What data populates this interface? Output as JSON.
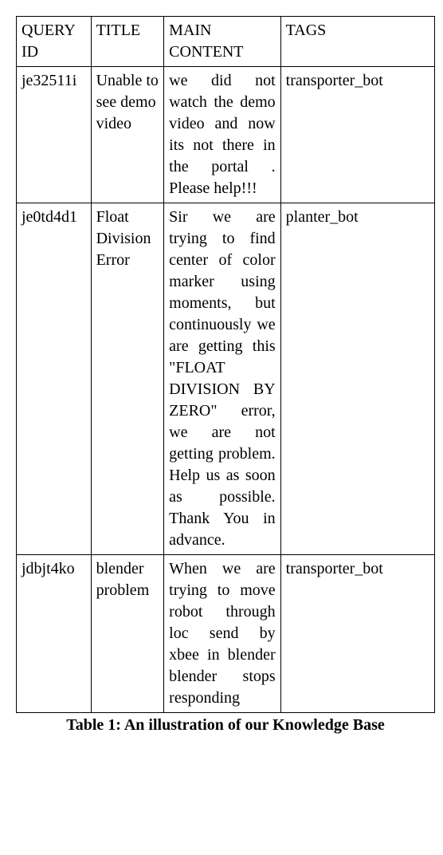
{
  "table": {
    "headers": {
      "query_id": "QUERY ID",
      "title": "TITLE",
      "main_content": "MAIN CONTENT",
      "tags": "TAGS"
    },
    "rows": [
      {
        "query_id": "je32511i",
        "title": "Unable to see demo video",
        "main_content": "we did not watch the demo video and now its not there in the portal . Please help!!!",
        "tags": "transporter_bot"
      },
      {
        "query_id": "je0td4d1",
        "title": "Float Division Error",
        "main_content": "Sir we are trying to find center of color marker using moments, but continuously we are getting this \"FLOAT DIVISION BY ZERO\" error, we are not getting problem. Help us as soon as possible. Thank You in advance.",
        "tags": "planter_bot"
      },
      {
        "query_id": "jdbjt4ko",
        "title": "blender problem",
        "main_content": "When we are trying to move robot through loc send by xbee in blender blender stops responding",
        "tags": "transporter_bot"
      }
    ]
  },
  "caption": "Table 1: An illustration of our Knowledge Base"
}
